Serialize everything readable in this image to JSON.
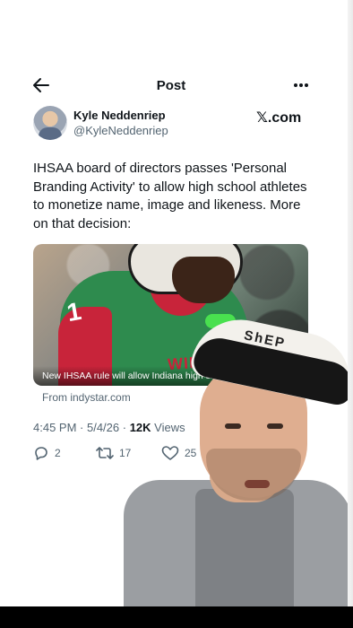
{
  "header": {
    "back_icon": "arrow-left-icon",
    "title": "Post",
    "more_icon": "more-horizontal-icon"
  },
  "author": {
    "name": "Kyle Neddenriep",
    "handle": "@KyleNeddenriep"
  },
  "brand": "𝕏.com",
  "tweet": {
    "text": "IHSAA board of directors passes 'Personal Branding Activity' to allow high school athletes to monetize name, image and likeness. More on that decision:"
  },
  "media": {
    "caption": "New IHSAA rule will allow Indiana high s",
    "jersey_number": "1",
    "wordmark": "WILDC",
    "source": "From indystar.com"
  },
  "meta": {
    "time": "4:45 PM",
    "separator1": " · ",
    "date": "5/4/26",
    "separator2": " · ",
    "views_count": "12K",
    "views_label": " Views"
  },
  "actions": {
    "replies": "2",
    "reposts": "17",
    "likes": "25"
  },
  "overlay": {
    "cap_text": "ShEP"
  },
  "colors": {
    "text": "#0f1419",
    "muted": "#536471",
    "jersey_green": "#2e8b4e",
    "jersey_red": "#c8243a"
  }
}
